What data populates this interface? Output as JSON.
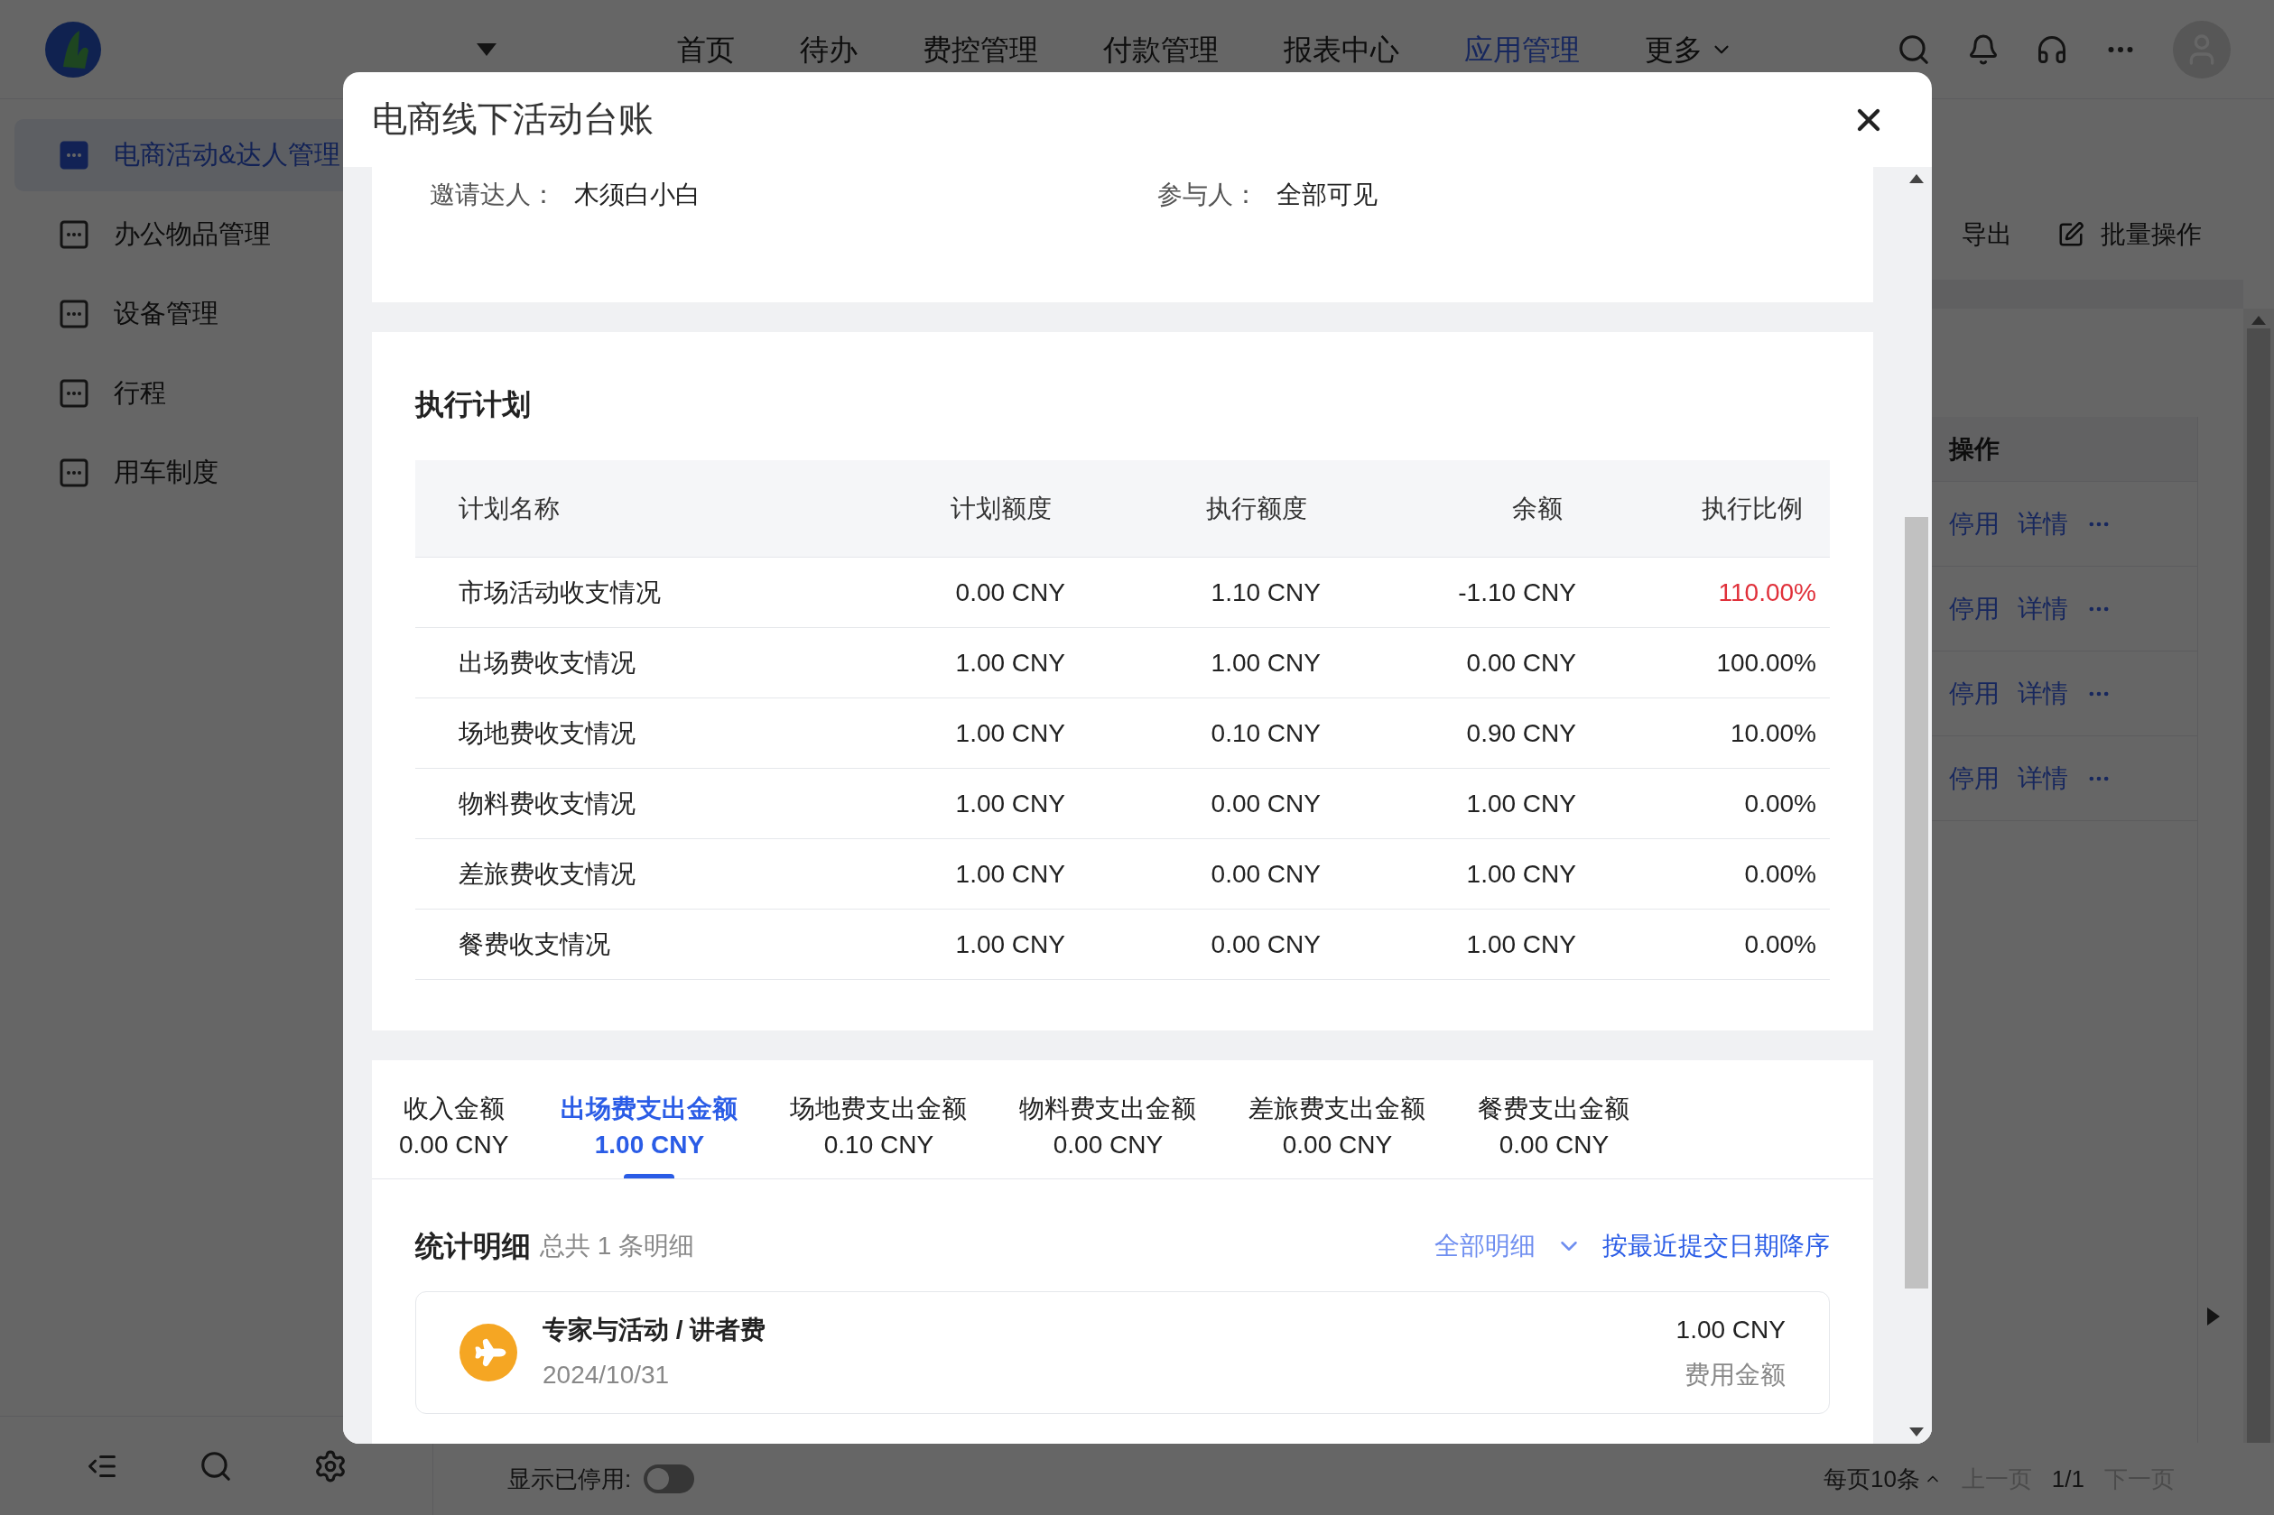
{
  "top_nav": {
    "items": [
      {
        "label": "首页",
        "selected": false
      },
      {
        "label": "待办",
        "selected": false
      },
      {
        "label": "费控管理",
        "selected": false
      },
      {
        "label": "付款管理",
        "selected": false
      },
      {
        "label": "报表中心",
        "selected": false
      },
      {
        "label": "应用管理",
        "selected": true
      },
      {
        "label": "更多",
        "selected": false,
        "has_menu": true
      }
    ]
  },
  "sidebar": {
    "items": [
      {
        "label": "电商活动&达人管理",
        "selected": true
      },
      {
        "label": "办公物品管理",
        "selected": false
      },
      {
        "label": "设备管理",
        "selected": false
      },
      {
        "label": "行程",
        "selected": false
      },
      {
        "label": "用车制度",
        "selected": false
      }
    ]
  },
  "toolbar": {
    "buttons": [
      "导出",
      "批量操作"
    ]
  },
  "list_table": {
    "action_header": "操作",
    "rows": [
      {
        "actions": [
          "停用",
          "详情"
        ]
      },
      {
        "actions": [
          "停用",
          "详情"
        ]
      },
      {
        "actions": [
          "停用",
          "详情"
        ]
      },
      {
        "actions": [
          "停用",
          "详情"
        ]
      }
    ]
  },
  "footer": {
    "show_disabled_label": "显示已停用:",
    "show_disabled_on": false,
    "page_size": "每页10条",
    "prev": "上一页",
    "page": "1/1",
    "next": "下一页"
  },
  "modal": {
    "title": "电商线下活动台账",
    "info": [
      {
        "label": "邀请达人：",
        "value": "木须白小白"
      },
      {
        "label": "参与人：",
        "value": "全部可见"
      }
    ],
    "plan": {
      "title": "执行计划",
      "columns": [
        "计划名称",
        "计划额度",
        "执行额度",
        "余额",
        "执行比例"
      ],
      "rows": [
        {
          "cells": [
            "市场活动收支情况",
            "0.00 CNY",
            "1.10 CNY",
            "-1.10 CNY",
            "110.00%"
          ],
          "alert": true
        },
        {
          "cells": [
            "出场费收支情况",
            "1.00 CNY",
            "1.00 CNY",
            "0.00 CNY",
            "100.00%"
          ],
          "alert": false
        },
        {
          "cells": [
            "场地费收支情况",
            "1.00 CNY",
            "0.10 CNY",
            "0.90 CNY",
            "10.00%"
          ],
          "alert": false
        },
        {
          "cells": [
            "物料费收支情况",
            "1.00 CNY",
            "0.00 CNY",
            "1.00 CNY",
            "0.00%"
          ],
          "alert": false
        },
        {
          "cells": [
            "差旅费收支情况",
            "1.00 CNY",
            "0.00 CNY",
            "1.00 CNY",
            "0.00%"
          ],
          "alert": false
        },
        {
          "cells": [
            "餐费收支情况",
            "1.00 CNY",
            "0.00 CNY",
            "1.00 CNY",
            "0.00%"
          ],
          "alert": false
        }
      ]
    },
    "amount_tabs": [
      {
        "label": "收入金额",
        "value": "0.00 CNY",
        "selected": false
      },
      {
        "label": "出场费支出金额",
        "value": "1.00 CNY",
        "selected": true
      },
      {
        "label": "场地费支出金额",
        "value": "0.10 CNY",
        "selected": false
      },
      {
        "label": "物料费支出金额",
        "value": "0.00 CNY",
        "selected": false
      },
      {
        "label": "差旅费支出金额",
        "value": "0.00 CNY",
        "selected": false
      },
      {
        "label": "餐费支出金额",
        "value": "0.00 CNY",
        "selected": false
      }
    ],
    "details": {
      "title": "统计明细",
      "count": "总共 1 条明细",
      "filter": "全部明细",
      "sort": "按最近提交日期降序",
      "items": [
        {
          "title": "专家与活动 / 讲者费",
          "date": "2024/10/31",
          "amount": "1.00 CNY",
          "amount_label": "费用金额"
        }
      ]
    }
  }
}
